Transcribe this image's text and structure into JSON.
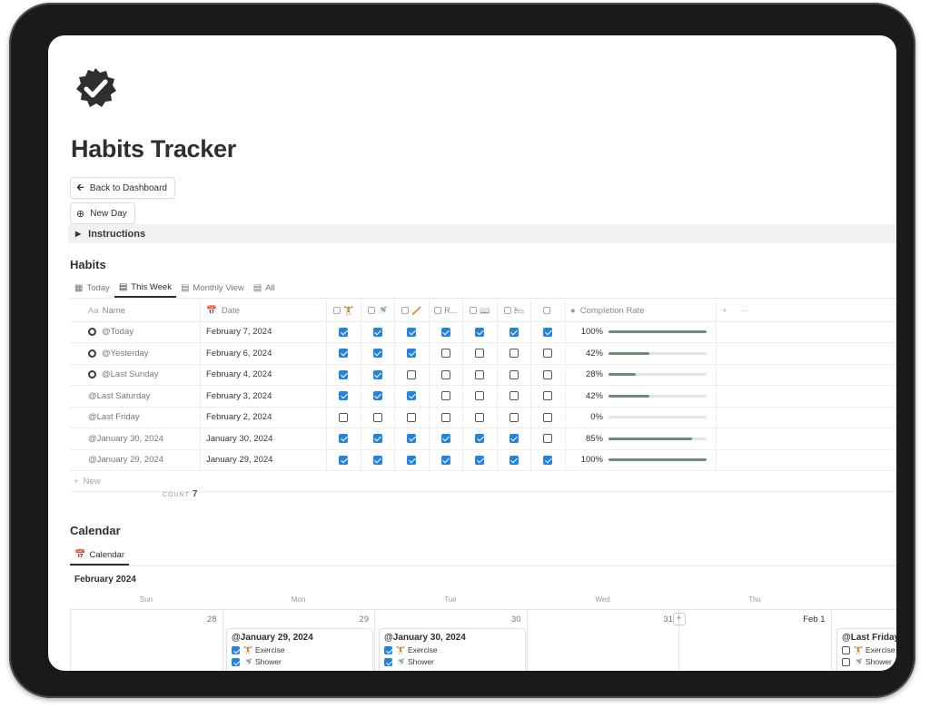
{
  "page": {
    "title": "Habits Tracker",
    "icon": "verified-badge-icon"
  },
  "buttons": {
    "back": "Back to Dashboard",
    "new_day": "New Day"
  },
  "toggle": {
    "label": "Instructions"
  },
  "habits": {
    "heading": "Habits",
    "tabs": [
      {
        "label": "Today",
        "icon": "gallery-icon"
      },
      {
        "label": "This Week",
        "icon": "table-icon",
        "active": true
      },
      {
        "label": "Monthly View",
        "icon": "table-icon"
      },
      {
        "label": "All",
        "icon": "table-icon"
      }
    ],
    "columns": {
      "name": "Name",
      "name_prefix": "Aa",
      "date": "Date",
      "habit_icons": [
        "🏋",
        "🚿",
        "🪥",
        "R...",
        "📖",
        "🛏",
        ""
      ],
      "rate": "Completion Rate"
    },
    "rows": [
      {
        "name": "@Today",
        "dot": true,
        "date": "February 7, 2024",
        "checks": [
          true,
          true,
          true,
          true,
          true,
          true,
          true
        ],
        "pct": "100%",
        "rate": 1.0
      },
      {
        "name": "@Yesterday",
        "dot": true,
        "date": "February 6, 2024",
        "checks": [
          true,
          true,
          true,
          false,
          false,
          false,
          false
        ],
        "pct": "42%",
        "rate": 0.42
      },
      {
        "name": "@Last Sunday",
        "dot": true,
        "date": "February 4, 2024",
        "checks": [
          true,
          true,
          false,
          false,
          false,
          false,
          false
        ],
        "pct": "28%",
        "rate": 0.28
      },
      {
        "name": "@Last Saturday",
        "dot": false,
        "date": "February 3, 2024",
        "checks": [
          true,
          true,
          true,
          false,
          false,
          false,
          false
        ],
        "pct": "42%",
        "rate": 0.42
      },
      {
        "name": "@Last Friday",
        "dot": false,
        "date": "February 2, 2024",
        "checks": [
          false,
          false,
          false,
          false,
          false,
          false,
          false
        ],
        "pct": "0%",
        "rate": 0.0
      },
      {
        "name": "@January 30, 2024",
        "dot": false,
        "date": "January 30, 2024",
        "checks": [
          true,
          true,
          true,
          true,
          true,
          true,
          false
        ],
        "pct": "85%",
        "rate": 0.85
      },
      {
        "name": "@January 29, 2024",
        "dot": false,
        "date": "January 29, 2024",
        "checks": [
          true,
          true,
          true,
          true,
          true,
          true,
          true
        ],
        "pct": "100%",
        "rate": 1.0
      }
    ],
    "new_label": "New",
    "count_label": "COUNT",
    "count_value": "7"
  },
  "calendar": {
    "heading": "Calendar",
    "tab": "Calendar",
    "month": "February 2024",
    "weekdays": [
      "Sun",
      "Mon",
      "Tue",
      "Wed",
      "Thu"
    ],
    "days": [
      "28",
      "29",
      "30",
      "31",
      "Feb 1"
    ],
    "cards": [
      {
        "title": "@January 29, 2024",
        "items": [
          {
            "label": "Exercise",
            "checked": true,
            "icon": "🏋"
          },
          {
            "label": "Shower",
            "checked": true,
            "icon": "🚿"
          }
        ]
      },
      {
        "title": "@January 30, 2024",
        "items": [
          {
            "label": "Exercise",
            "checked": true,
            "icon": "🏋"
          },
          {
            "label": "Shower",
            "checked": true,
            "icon": "🚿"
          }
        ]
      },
      {
        "title": "@Last Friday",
        "items": [
          {
            "label": "Exercise",
            "checked": false,
            "icon": "🏋"
          },
          {
            "label": "Shower",
            "checked": false,
            "icon": "🚿"
          }
        ]
      }
    ]
  },
  "colors": {
    "accent": "#2383e2",
    "progress": "#6b8e74"
  }
}
